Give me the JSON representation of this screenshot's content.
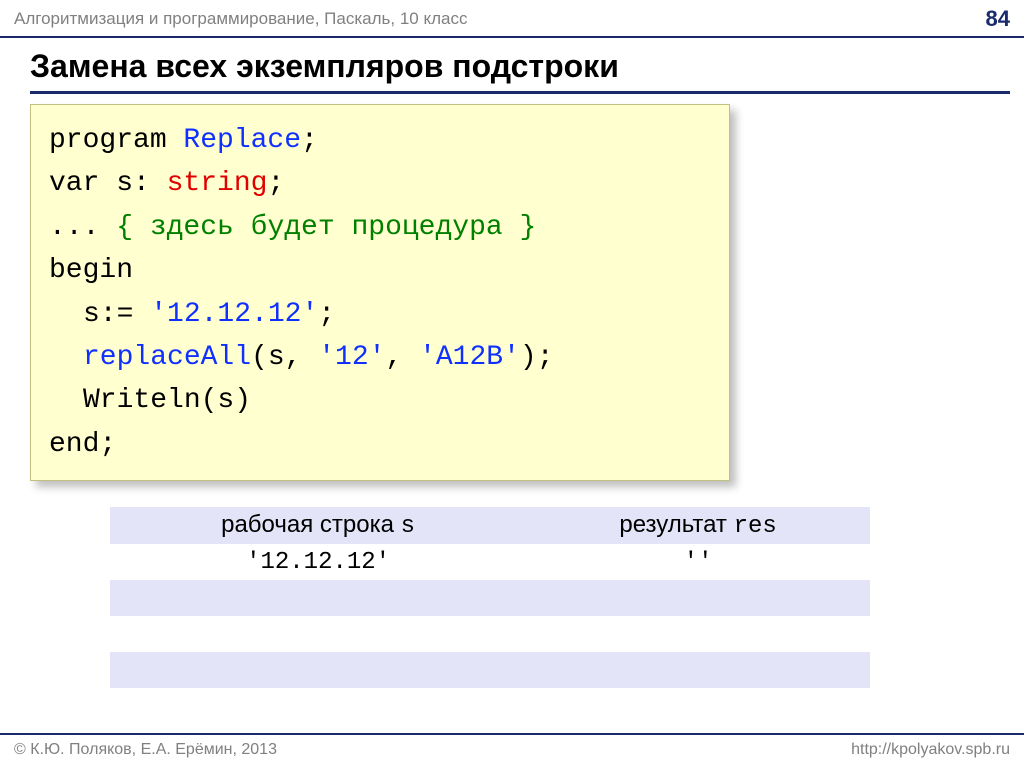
{
  "header": {
    "subject": "Алгоритмизация и программирование, Паскаль, 10 класс",
    "page": "84"
  },
  "title": "Замена всех экземпляров подстроки",
  "code": {
    "l1a": "program ",
    "l1b": "Replace",
    "l1c": ";",
    "l2a": "var s: ",
    "l2b": "string",
    "l2c": ";",
    "l3a": "... ",
    "l3b": "{ здесь будет процедура }",
    "l4": "begin",
    "l5a": "s:= ",
    "l5b": "'12.12.12'",
    "l5c": ";",
    "l6a": "replaceAll",
    "l6b": "(s, ",
    "l6c": "'12'",
    "l6d": ", ",
    "l6e": "'A12B'",
    "l6f": ");",
    "l7": "Writeln(s)",
    "l8": "end;"
  },
  "table": {
    "h1a": "рабочая строка ",
    "h1b": "s",
    "h2a": "результат ",
    "h2b": "res",
    "r1c1": "'12.12.12'",
    "r1c2": "''"
  },
  "footer": {
    "left": "© К.Ю. Поляков, Е.А. Ерёмин, 2013",
    "right": "http://kpolyakov.spb.ru"
  }
}
